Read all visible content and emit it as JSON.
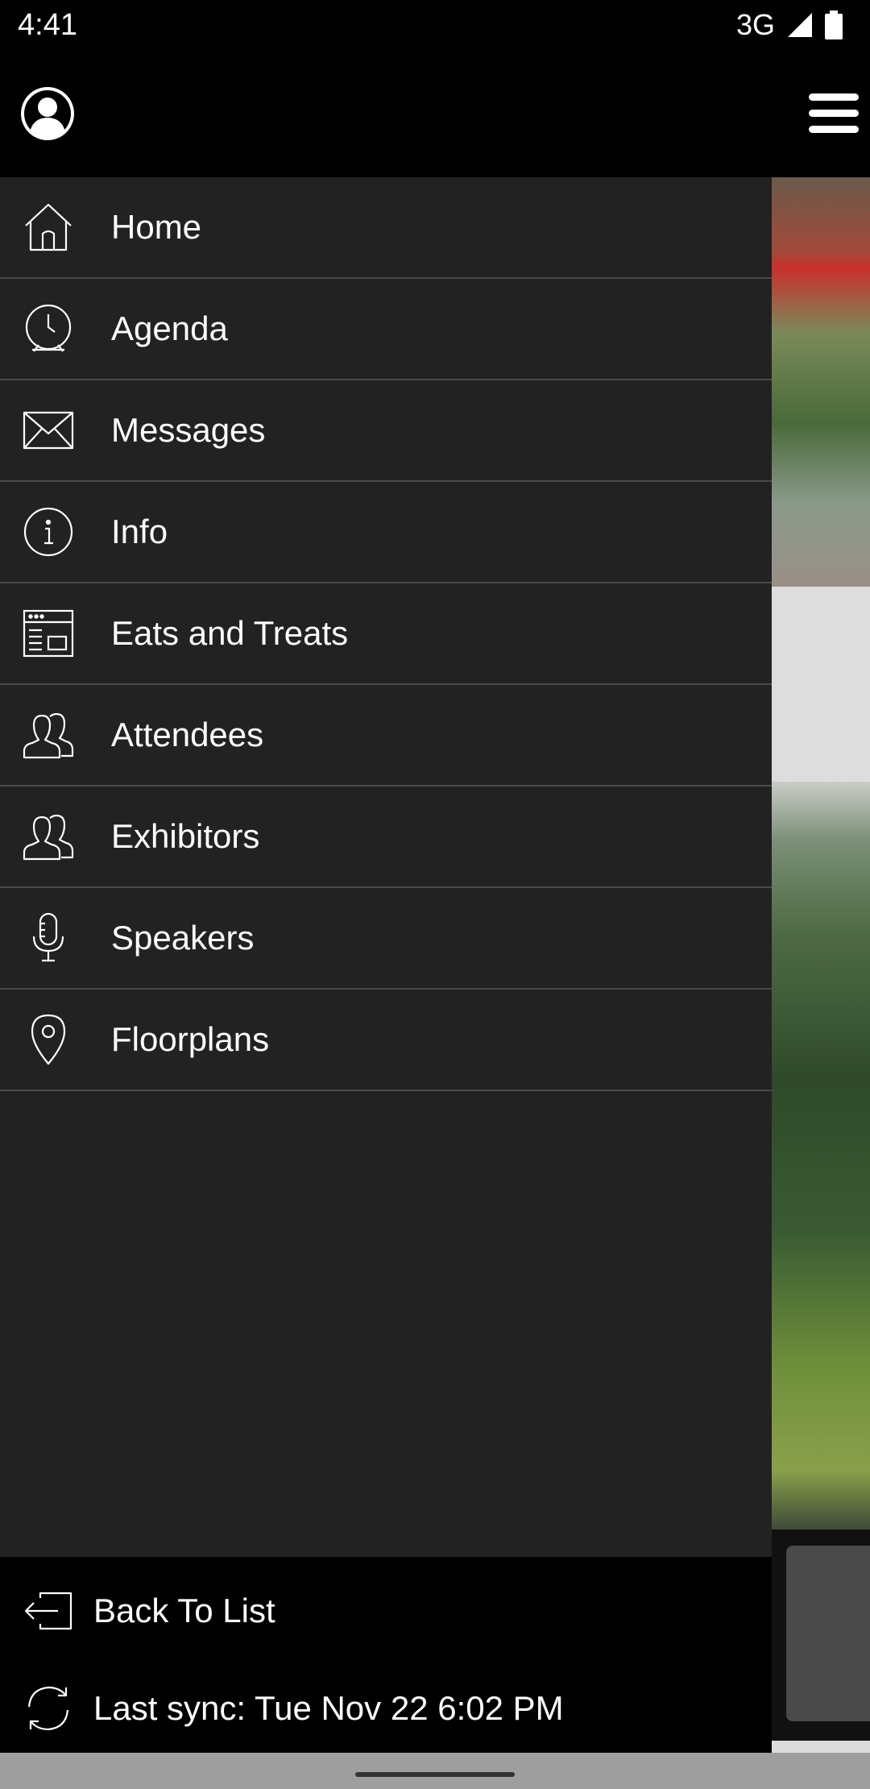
{
  "status_bar": {
    "time": "4:41",
    "network": "3G"
  },
  "app_bar": {
    "avatar_icon": "user-avatar-icon",
    "menu_icon": "hamburger-menu-icon"
  },
  "drawer": {
    "items": [
      {
        "label": "Home",
        "icon": "home-icon"
      },
      {
        "label": "Agenda",
        "icon": "clock-icon"
      },
      {
        "label": "Messages",
        "icon": "envelope-icon"
      },
      {
        "label": "Info",
        "icon": "info-icon"
      },
      {
        "label": "Eats and Treats",
        "icon": "menu-card-icon"
      },
      {
        "label": "Attendees",
        "icon": "people-icon"
      },
      {
        "label": "Exhibitors",
        "icon": "people-icon"
      },
      {
        "label": "Speakers",
        "icon": "microphone-icon"
      },
      {
        "label": "Floorplans",
        "icon": "map-pin-icon"
      }
    ],
    "footer": {
      "back_label": "Back To List",
      "sync_label": "Last sync: Tue Nov 22 6:02 PM"
    }
  },
  "colors": {
    "drawer_bg": "#222222",
    "divider": "#4a4a4a",
    "bar_bg": "#000000",
    "text": "#ffffff"
  }
}
